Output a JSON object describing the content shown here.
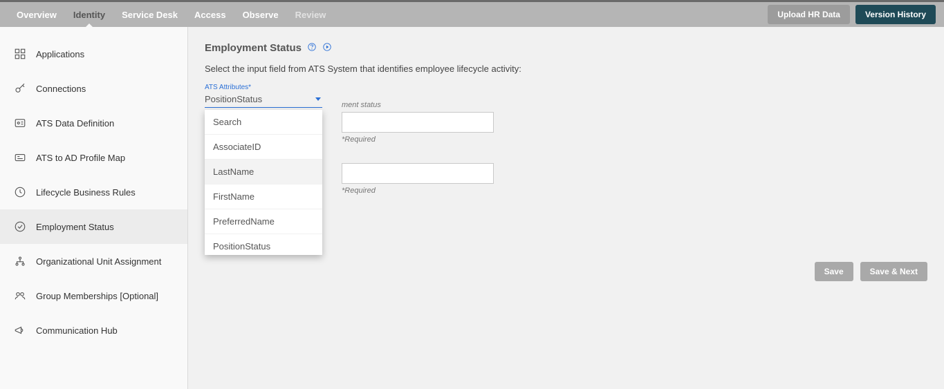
{
  "nav": {
    "items": [
      {
        "label": "Overview"
      },
      {
        "label": "Identity"
      },
      {
        "label": "Service Desk"
      },
      {
        "label": "Access"
      },
      {
        "label": "Observe"
      },
      {
        "label": "Review"
      }
    ],
    "active_index": 1
  },
  "top_buttons": {
    "upload": "Upload HR Data",
    "version": "Version History"
  },
  "sidebar": {
    "items": [
      {
        "label": "Applications",
        "icon": "grid-icon"
      },
      {
        "label": "Connections",
        "icon": "key-icon"
      },
      {
        "label": "ATS Data Definition",
        "icon": "id-card-icon"
      },
      {
        "label": "ATS to AD Profile Map",
        "icon": "badge-icon"
      },
      {
        "label": "Lifecycle Business Rules",
        "icon": "clock-icon"
      },
      {
        "label": "Employment Status",
        "icon": "check-circle-icon"
      },
      {
        "label": "Organizational Unit Assignment",
        "icon": "org-icon"
      },
      {
        "label": "Group Memberships [Optional]",
        "icon": "group-icon"
      },
      {
        "label": "Communication Hub",
        "icon": "megaphone-icon"
      }
    ],
    "selected_index": 5
  },
  "page": {
    "title": "Employment Status",
    "subtitle": "Select the input field from ATS System that identifies employee lifecycle activity:",
    "ats_label": "ATS Attributes*",
    "selected_attribute": "PositionStatus",
    "dropdown": {
      "search_label": "Search",
      "options": [
        "AssociateID",
        "LastName",
        "FirstName",
        "PreferredName",
        "PositionStatus"
      ],
      "hover_index": 1
    },
    "status_partial_label": "ment status",
    "required_hint": "*Required",
    "input1_value": "",
    "input2_value": ""
  },
  "actions": {
    "save": "Save",
    "save_next": "Save & Next"
  }
}
